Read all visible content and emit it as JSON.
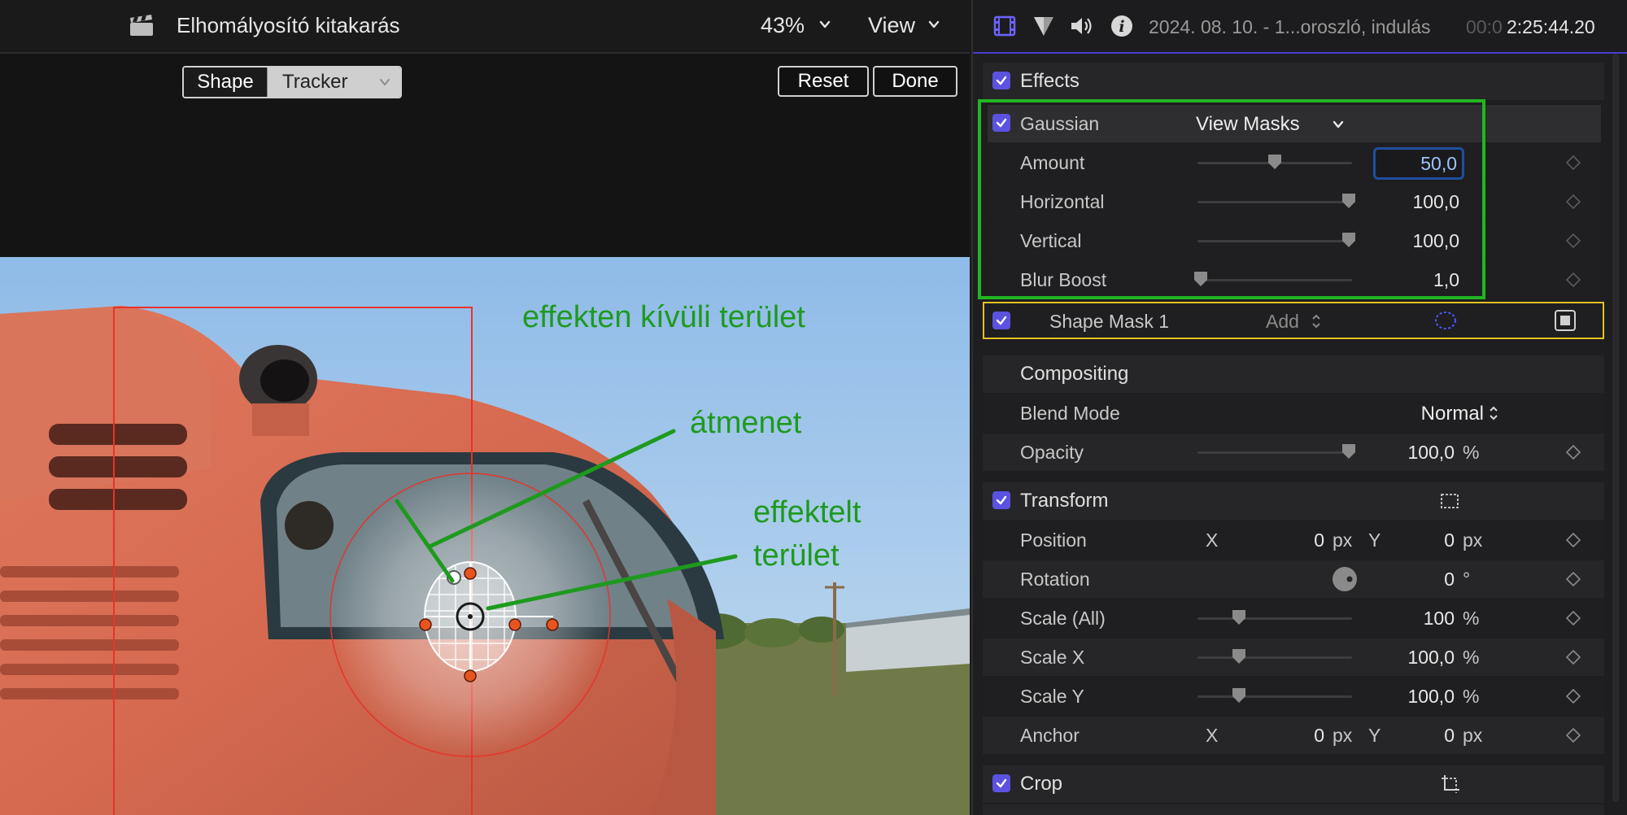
{
  "viewer": {
    "title": "Elhomályosító kitakarás",
    "zoom": "43%",
    "view_label": "View",
    "segment": {
      "shape": "Shape",
      "tracker": "Tracker"
    },
    "reset_label": "Reset",
    "done_label": "Done",
    "annotations": {
      "outside": "effekten kívüli terület",
      "transition": "átmenet",
      "affected_line1": "effektelt",
      "affected_line2": "terület"
    }
  },
  "inspector": {
    "clip_info": "2024. 08. 10. - 1...oroszló, indulás",
    "timecode_dim": "00:0",
    "timecode": "2:25:44.20",
    "effects_label": "Effects",
    "gaussian": {
      "label": "Gaussian",
      "view_masks": "View Masks",
      "params": [
        {
          "label": "Amount",
          "value": "50,0",
          "level": 0.5
        },
        {
          "label": "Horizontal",
          "value": "100,0",
          "level": 0.98
        },
        {
          "label": "Vertical",
          "value": "100,0",
          "level": 0.98
        },
        {
          "label": "Blur Boost",
          "value": "1,0",
          "level": 0.02
        }
      ]
    },
    "shape_mask": {
      "label": "Shape Mask 1",
      "mode": "Add"
    },
    "compositing": {
      "label": "Compositing",
      "blend_mode_label": "Blend Mode",
      "blend_mode": "Normal",
      "opacity_label": "Opacity",
      "opacity": "100,0",
      "opacity_unit": "%",
      "opacity_level": 0.98
    },
    "transform": {
      "label": "Transform",
      "position_label": "Position",
      "position_x_axis": "X",
      "position_x": "0",
      "position_x_unit": "px",
      "position_y_axis": "Y",
      "position_y": "0",
      "position_y_unit": "px",
      "rotation_label": "Rotation",
      "rotation": "0",
      "rotation_unit": "°",
      "scale_all_label": "Scale (All)",
      "scale_all": "100",
      "scale_all_unit": "%",
      "scale_all_level": 0.27,
      "scale_x_label": "Scale X",
      "scale_x": "100,0",
      "scale_x_unit": "%",
      "scale_x_level": 0.27,
      "scale_y_label": "Scale Y",
      "scale_y": "100,0",
      "scale_y_unit": "%",
      "scale_y_level": 0.27,
      "anchor_label": "Anchor",
      "anchor_x_axis": "X",
      "anchor_x": "0",
      "anchor_x_unit": "px",
      "anchor_y_axis": "Y",
      "anchor_y": "0",
      "anchor_y_unit": "px"
    },
    "crop_label": "Crop"
  },
  "colors": {
    "accent": "#5b52e0",
    "annotation_green": "#1e9a1e",
    "highlight_green": "#22b522",
    "mask_yellow": "#e6c21e",
    "focus_blue": "#1f4fa0"
  }
}
